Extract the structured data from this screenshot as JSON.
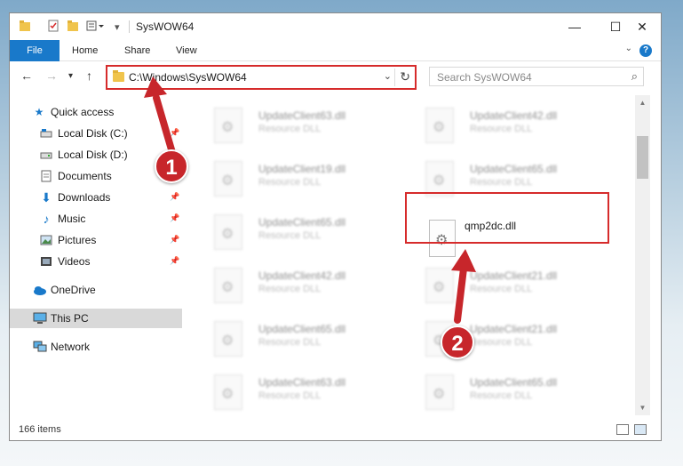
{
  "window": {
    "title": "SysWOW64",
    "controls": {
      "minimize": "—",
      "maximize": "☐",
      "close": "✕"
    }
  },
  "ribbon": {
    "tabs": [
      "File",
      "Home",
      "Share",
      "View"
    ],
    "help": "?"
  },
  "address": {
    "path": "C:\\Windows\\SysWOW64",
    "search_placeholder": "Search SysWOW64"
  },
  "sidebar": {
    "quick_access": "Quick access",
    "items": [
      {
        "label": "Local Disk (C:)",
        "icon": "drive-icon",
        "pinned": true
      },
      {
        "label": "Local Disk (D:)",
        "icon": "drive-icon",
        "pinned": false
      },
      {
        "label": "Documents",
        "icon": "documents-icon",
        "pinned": false
      },
      {
        "label": "Downloads",
        "icon": "downloads-icon",
        "pinned": true
      },
      {
        "label": "Music",
        "icon": "music-icon",
        "pinned": true
      },
      {
        "label": "Pictures",
        "icon": "pictures-icon",
        "pinned": true
      },
      {
        "label": "Videos",
        "icon": "videos-icon",
        "pinned": true
      }
    ],
    "onedrive": "OneDrive",
    "this_pc": "This PC",
    "network": "Network"
  },
  "files": {
    "left": [
      {
        "name": "UpdateClient63.dll",
        "desc": "Resource DLL"
      },
      {
        "name": "UpdateClient19.dll",
        "desc": "Resource DLL"
      },
      {
        "name": "UpdateClient65.dll",
        "desc": "Resource DLL"
      },
      {
        "name": "UpdateClient42.dll",
        "desc": "Resource DLL"
      },
      {
        "name": "UpdateClient65.dll",
        "desc": "Resource DLL"
      },
      {
        "name": "UpdateClient63.dll",
        "desc": "Resource DLL"
      }
    ],
    "right": [
      {
        "name": "UpdateClient42.dll",
        "desc": "Resource DLL"
      },
      {
        "name": "UpdateClient65.dll",
        "desc": "Resource DLL"
      },
      {
        "name": "qmp2dc.dll",
        "desc": ""
      },
      {
        "name": "UpdateClient21.dll",
        "desc": "Resource DLL"
      },
      {
        "name": "UpdateClient21.dll",
        "desc": "Resource DLL"
      },
      {
        "name": "UpdateClient65.dll",
        "desc": "Resource DLL"
      }
    ]
  },
  "status": {
    "count": "166 items"
  },
  "annotations": {
    "badge1": "1",
    "badge2": "2",
    "color": "#c7262b"
  }
}
